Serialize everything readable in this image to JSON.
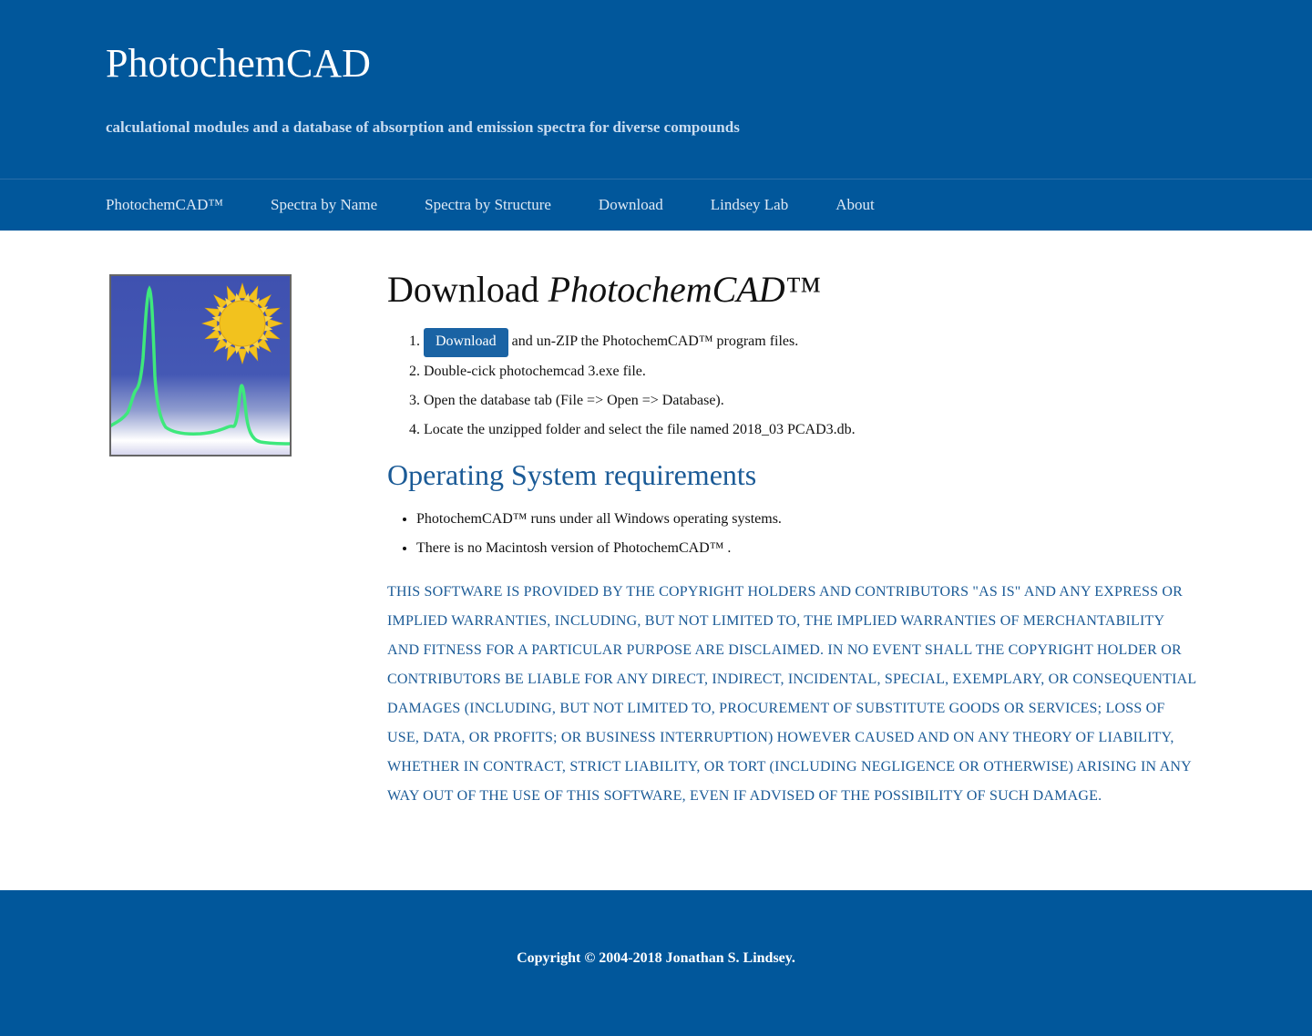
{
  "site": {
    "title": "PhotochemCAD",
    "tagline": "calculational modules and a database of absorption and emission spectra for diverse compounds"
  },
  "nav": {
    "items": [
      {
        "label": "PhotochemCAD™"
      },
      {
        "label": "Spectra by Name"
      },
      {
        "label": "Spectra by Structure"
      },
      {
        "label": "Download"
      },
      {
        "label": "Lindsey Lab"
      },
      {
        "label": "About"
      }
    ]
  },
  "main": {
    "title_prefix": "Download ",
    "title_emphasis": "PhotochemCAD™",
    "download_button": "Download",
    "steps": [
      {
        "text": " and un-ZIP the PhotochemCAD™  program files."
      },
      {
        "text": "Double-cick photochemcad 3.exe file."
      },
      {
        "text": "Open the database tab (File => Open => Database)."
      },
      {
        "text": "Locate the unzipped folder and select the file named 2018_03 PCAD3.db."
      }
    ],
    "os_heading": "Operating System requirements",
    "os_requirements": [
      "PhotochemCAD™  runs under all Windows operating systems.",
      "There is no Macintosh version of PhotochemCAD™ ."
    ],
    "disclaimer": "THIS SOFTWARE IS PROVIDED BY THE COPYRIGHT HOLDERS AND CONTRIBUTORS \"AS IS\" AND ANY EXPRESS OR IMPLIED WARRANTIES, INCLUDING, BUT NOT LIMITED TO, THE IMPLIED WARRANTIES OF MERCHANTABILITY AND FITNESS FOR A PARTICULAR PURPOSE ARE DISCLAIMED. IN NO EVENT SHALL THE COPYRIGHT HOLDER OR CONTRIBUTORS BE LIABLE FOR ANY DIRECT, INDIRECT, INCIDENTAL, SPECIAL, EXEMPLARY, OR CONSEQUENTIAL DAMAGES (INCLUDING, BUT NOT LIMITED TO, PROCUREMENT OF SUBSTITUTE GOODS OR SERVICES; LOSS OF USE, DATA, OR PROFITS; OR BUSINESS INTERRUPTION) HOWEVER CAUSED AND ON ANY THEORY OF LIABILITY, WHETHER IN CONTRACT, STRICT LIABILITY, OR TORT (INCLUDING NEGLIGENCE OR OTHERWISE) ARISING IN ANY WAY OUT OF THE USE OF THIS SOFTWARE, EVEN IF ADVISED OF THE POSSIBILITY OF SUCH DAMAGE."
  },
  "footer": {
    "copyright": "Copyright © 2004-2018 Jonathan S. Lindsey."
  },
  "logo": {
    "icon": "spectrum-sun-icon"
  },
  "colors": {
    "brand_blue": "#01579b",
    "heading_blue": "#1a5a96",
    "button_blue": "#1a63a4",
    "spectrum_green": "#3ee87c",
    "sun_yellow": "#f2c21e"
  }
}
